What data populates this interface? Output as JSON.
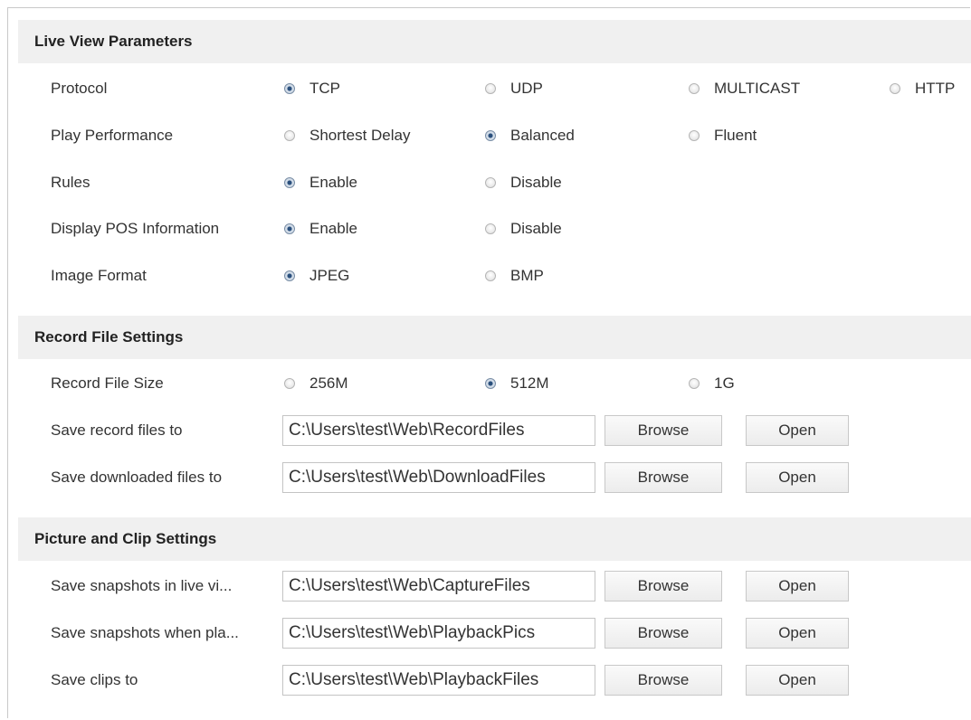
{
  "sections": {
    "live_view": {
      "title": "Live View Parameters"
    },
    "record_file": {
      "title": "Record File Settings"
    },
    "picture_clip": {
      "title": "Picture and Clip Settings"
    }
  },
  "live_view": {
    "protocol": {
      "label": "Protocol",
      "options": [
        "TCP",
        "UDP",
        "MULTICAST",
        "HTTP"
      ],
      "selected": "TCP"
    },
    "play_performance": {
      "label": "Play Performance",
      "options": [
        "Shortest Delay",
        "Balanced",
        "Fluent"
      ],
      "selected": "Balanced"
    },
    "rules": {
      "label": "Rules",
      "options": [
        "Enable",
        "Disable"
      ],
      "selected": "Enable"
    },
    "display_pos": {
      "label": "Display POS Information",
      "options": [
        "Enable",
        "Disable"
      ],
      "selected": "Enable"
    },
    "image_format": {
      "label": "Image Format",
      "options": [
        "JPEG",
        "BMP"
      ],
      "selected": "JPEG"
    }
  },
  "record_file": {
    "file_size": {
      "label": "Record File Size",
      "options": [
        "256M",
        "512M",
        "1G"
      ],
      "selected": "512M"
    },
    "record_path": {
      "label": "Save record files to",
      "value": "C:\\Users\\test\\Web\\RecordFiles"
    },
    "download_path": {
      "label": "Save downloaded files to",
      "value": "C:\\Users\\test\\Web\\DownloadFiles"
    }
  },
  "picture_clip": {
    "snapshot_live_path": {
      "label": "Save snapshots in live vi...",
      "value": "C:\\Users\\test\\Web\\CaptureFiles"
    },
    "snapshot_playback_path": {
      "label": "Save snapshots when pla...",
      "value": "C:\\Users\\test\\Web\\PlaybackPics"
    },
    "clips_path": {
      "label": "Save clips to",
      "value": "C:\\Users\\test\\Web\\PlaybackFiles"
    }
  },
  "buttons": {
    "browse": "Browse",
    "open": "Open"
  }
}
